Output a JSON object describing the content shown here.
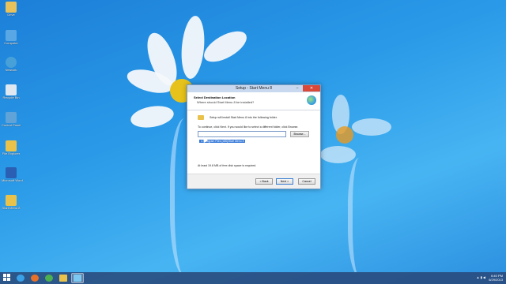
{
  "desktop": {
    "icons": [
      {
        "label": "Drive",
        "color": "#e7c15b",
        "icon": "folder-icon"
      },
      {
        "label": "Computer",
        "color": "#5aa7e6",
        "icon": "computer-icon"
      },
      {
        "label": "Network",
        "color": "#48a0d9",
        "icon": "network-icon"
      },
      {
        "label": "Recycle Bin",
        "color": "#dfe8f1",
        "icon": "recycle-bin-icon"
      },
      {
        "label": "Control Panel",
        "color": "#5fa3d8",
        "icon": "control-panel-icon"
      },
      {
        "label": "File Explorer",
        "color": "#e8c24a",
        "icon": "file-explorer-icon"
      },
      {
        "label": "Microsoft Word",
        "color": "#2b5fb4",
        "icon": "word-icon"
      },
      {
        "label": "Start Menu 8",
        "color": "#e8c24a",
        "icon": "folder-icon"
      }
    ]
  },
  "dialog": {
    "title": "Setup - Start Menu 8",
    "minimize": "–",
    "close": "✕",
    "header_title": "Select Destination Location",
    "header_subtitle": "Where should Start Menu 8 be installed?",
    "install_text": "Setup will install Start Menu 8 into the following folder.",
    "continue_text": "To continue, click Next. If you would like to select a different folder, click Browse.",
    "path_value": "C:\\Program Files (x86)\\Start Menu 8",
    "browse_label": "Browse...",
    "space_text": "At least 19.8 MB of free disk space is required.",
    "back_label": "< Back",
    "next_label": "Next >",
    "cancel_label": "Cancel"
  },
  "taskbar": {
    "items": [
      {
        "icon": "ie-icon",
        "color": "#3aa0e8"
      },
      {
        "icon": "firefox-icon",
        "color": "#e8712a"
      },
      {
        "icon": "chrome-icon",
        "color": "#4caf50"
      },
      {
        "icon": "file-explorer-icon",
        "color": "#e8c24a"
      },
      {
        "icon": "setup-icon",
        "color": "#7cc8f0"
      }
    ],
    "clock_time": "6:40 PM",
    "clock_date": "6/29/2013"
  }
}
